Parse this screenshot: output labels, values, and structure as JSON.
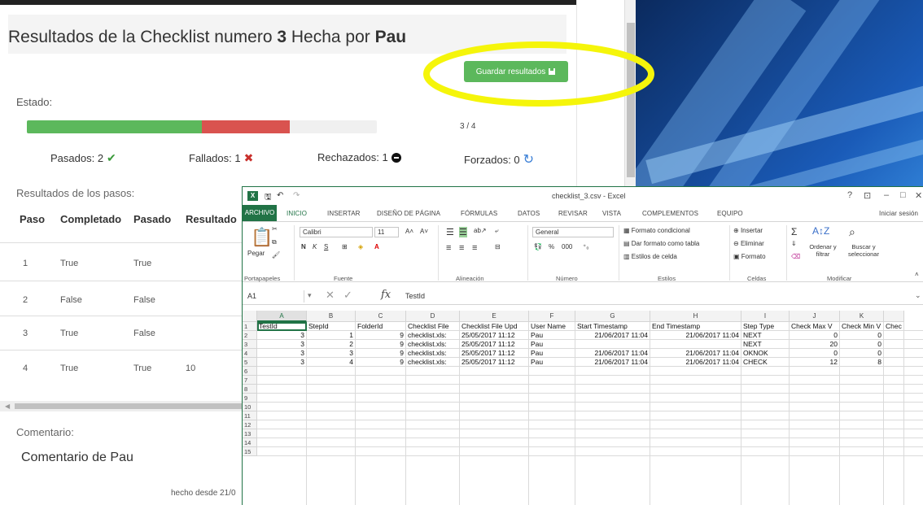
{
  "web": {
    "title_prefix": "Resultados de la Checklist numero",
    "checklist_number": "3",
    "title_middle": "Hecha por",
    "author": "Pau",
    "save_button": "Guardar resultados",
    "estado_label": "Estado:",
    "progress": {
      "passed": 2,
      "failed": 1,
      "total": 4,
      "text": "3 / 4"
    },
    "stats": {
      "passed": "Pasados: 2",
      "failed": "Fallados: 1",
      "rejected": "Rechazados: 1",
      "forced": "Forzados: 0"
    },
    "steps_label": "Resultados de los pasos:",
    "table": {
      "headers": [
        "Paso",
        "Completado",
        "Pasado",
        "Resultado"
      ],
      "rows": [
        [
          "1",
          "True",
          "True",
          ""
        ],
        [
          "2",
          "False",
          "False",
          ""
        ],
        [
          "3",
          "True",
          "False",
          ""
        ],
        [
          "4",
          "True",
          "True",
          "10"
        ]
      ]
    },
    "comment_label": "Comentario:",
    "comment_text": "Comentario de Pau",
    "footer": "hecho desde 21/0"
  },
  "colors": {
    "success": "#5cb85c",
    "danger": "#d9534f",
    "excel_green": "#217346",
    "highlight": "#f5f50a"
  },
  "excel": {
    "window_title": "checklist_3.csv - Excel",
    "tabs": [
      "ARCHIVO",
      "INICIO",
      "INSERTAR",
      "DISEÑO DE PÁGINA",
      "FÓRMULAS",
      "DATOS",
      "REVISAR",
      "VISTA",
      "COMPLEMENTOS",
      "EQUIPO"
    ],
    "signin": "Iniciar sesión",
    "ribbon": {
      "paste": "Pegar",
      "font_name": "Calibri",
      "font_size": "11",
      "number_format": "General",
      "cond_format": "Formato condicional",
      "table_format": "Dar formato como tabla",
      "cell_styles": "Estilos de celda",
      "insert": "Insertar",
      "delete": "Eliminar",
      "format": "Formato",
      "sort": "Ordenar y filtrar",
      "find": "Buscar y seleccionar",
      "groups": [
        "Portapapeles",
        "Fuente",
        "Alineación",
        "Número",
        "Estilos",
        "Celdas",
        "Modificar"
      ]
    },
    "name_box": "A1",
    "formula_value": "TestId",
    "columns": [
      "A",
      "B",
      "C",
      "D",
      "E",
      "F",
      "G",
      "H",
      "I",
      "J",
      "K"
    ],
    "headers": [
      "TestId",
      "StepId",
      "FolderId",
      "Checklist File",
      "Checklist File Upd",
      "User Name",
      "Start Timestamp",
      "End Timestamp",
      "Step Type",
      "Check Max V",
      "Check Min V",
      "Chec"
    ],
    "rows": [
      [
        "3",
        "1",
        "9",
        "checklist.xls:",
        "25/05/2017 11:12",
        "Pau",
        "21/06/2017 11:04",
        "21/06/2017 11:04",
        "NEXT",
        "0",
        "0"
      ],
      [
        "3",
        "2",
        "9",
        "checklist.xls:",
        "25/05/2017 11:12",
        "Pau",
        "",
        "",
        "NEXT",
        "20",
        "0"
      ],
      [
        "3",
        "3",
        "9",
        "checklist.xls:",
        "25/05/2017 11:12",
        "Pau",
        "21/06/2017 11:04",
        "21/06/2017 11:04",
        "OKNOK",
        "0",
        "0"
      ],
      [
        "3",
        "4",
        "9",
        "checklist.xls:",
        "25/05/2017 11:12",
        "Pau",
        "21/06/2017 11:04",
        "21/06/2017 11:04",
        "CHECK",
        "12",
        "8"
      ]
    ],
    "row_numbers": [
      "1",
      "2",
      "3",
      "4",
      "5",
      "6",
      "7",
      "8",
      "9",
      "10",
      "11",
      "12",
      "13",
      "14",
      "15"
    ]
  }
}
